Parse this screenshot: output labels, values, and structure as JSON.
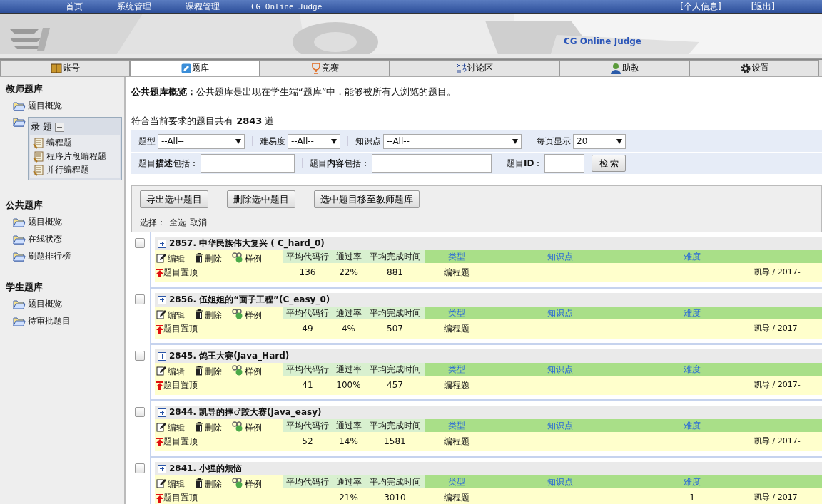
{
  "top_nav": {
    "items": [
      "首页",
      "系统管理",
      "课程管理"
    ],
    "brand": "CG Online Judge",
    "right": [
      "[个人信息]",
      "[退出]"
    ]
  },
  "banner": {
    "title": "CG Online Judge"
  },
  "tabs": [
    {
      "label": "账号",
      "selected": false
    },
    {
      "label": "题库",
      "selected": true
    },
    {
      "label": "竞赛",
      "selected": false
    },
    {
      "label": "讨论区",
      "selected": false
    },
    {
      "label": "助教",
      "selected": false
    },
    {
      "label": "设置",
      "selected": false
    }
  ],
  "sidebar": {
    "sections": [
      {
        "title": "教师题库",
        "items": [
          {
            "label": "题目概览"
          },
          {
            "label": "录 题",
            "expanded": true,
            "children": [
              {
                "label": "编程题"
              },
              {
                "label": "程序片段编程题"
              },
              {
                "label": "并行编程题"
              }
            ]
          }
        ]
      },
      {
        "title": "公共题库",
        "items": [
          {
            "label": "题目概览"
          },
          {
            "label": "在线状态"
          },
          {
            "label": "刷题排行榜"
          }
        ]
      },
      {
        "title": "学生题库",
        "items": [
          {
            "label": "题目概览"
          },
          {
            "label": "待审批题目"
          }
        ]
      }
    ]
  },
  "intro": "**公共题库概览：**公共题库是出现在学生端“题库”中，能够被所有人浏览的题目。",
  "count": "符合当前要求的题目共有 **2843** 道",
  "filters": {
    "selects": [
      {
        "label": "题型",
        "value": "--All--"
      },
      {
        "label": "难易度",
        "value": "--All--"
      },
      {
        "label": "知识点",
        "value": "--All--"
      },
      {
        "label": "每页显示",
        "value": "20"
      }
    ],
    "fields": [
      {
        "label": "题目**描述**包括："
      },
      {
        "label": "题目**内容**包括："
      },
      {
        "label": "题目**ID**："
      }
    ],
    "search_button": "检 索"
  },
  "bulk": {
    "buttons": [
      "导出选中题目",
      "删除选中题目",
      "选中题目移至教师题库"
    ],
    "select_label": "选择：",
    "select_links": [
      "全选",
      "取消"
    ]
  },
  "problems": [
    {
      "title": "2857. 中华民族伟大复兴 ( C_hard_0)",
      "checked": false,
      "actions": [
        "编辑",
        "删除",
        "样例"
      ],
      "pin": "题目置顶",
      "stat_headers": [
        "平均代码行",
        "通过率",
        "平均完成时间"
      ],
      "info_headers": [
        "类型",
        "知识点",
        "难度"
      ],
      "stats": [
        "136",
        "22%",
        "881"
      ],
      "type": "编程题",
      "author": "凯导 / 2017-"
    },
    {
      "title": "2856. 伍姐姐的“面子工程”(C_easy_0)",
      "checked": false,
      "actions": [
        "编辑",
        "删除",
        "样例"
      ],
      "pin": "题目置顶",
      "stat_headers": [
        "平均代码行",
        "通过率",
        "平均完成时间"
      ],
      "info_headers": [
        "类型",
        "知识点",
        "难度"
      ],
      "stats": [
        "49",
        "4%",
        "507"
      ],
      "type": "编程题",
      "author": "凯导 / 2017-"
    },
    {
      "title": "2845. 鸽王大赛(Java_Hard)",
      "checked": false,
      "actions": [
        "编辑",
        "删除",
        "样例"
      ],
      "pin": "题目置顶",
      "stat_headers": [
        "平均代码行",
        "通过率",
        "平均完成时间"
      ],
      "info_headers": [
        "类型",
        "知识点",
        "难度"
      ],
      "stats": [
        "41",
        "100%",
        "457"
      ],
      "type": "编程题",
      "author": "凯导 / 2017-"
    },
    {
      "title": "2844. 凯导的摔♂跤大赛(Java_easy)",
      "checked": false,
      "actions": [
        "编辑",
        "删除",
        "样例"
      ],
      "pin": "题目置顶",
      "stat_headers": [
        "平均代码行",
        "通过率",
        "平均完成时间"
      ],
      "info_headers": [
        "类型",
        "知识点",
        "难度"
      ],
      "stats": [
        "52",
        "14%",
        "1581"
      ],
      "type": "编程题",
      "author": "凯导 / 2017-"
    },
    {
      "title": "2841. 小狸的烦恼",
      "checked": false,
      "actions": [
        "编辑",
        "删除",
        "样例"
      ],
      "pin": "题目置顶",
      "stat_headers": [
        "平均代码行",
        "通过率",
        "平均完成时间"
      ],
      "info_headers": [
        "类型",
        "知识点",
        "难度"
      ],
      "stats": [
        "-",
        "21%",
        "3010"
      ],
      "type": "编程题",
      "difficulty": "1",
      "author": "凯导 / 2017-"
    }
  ]
}
